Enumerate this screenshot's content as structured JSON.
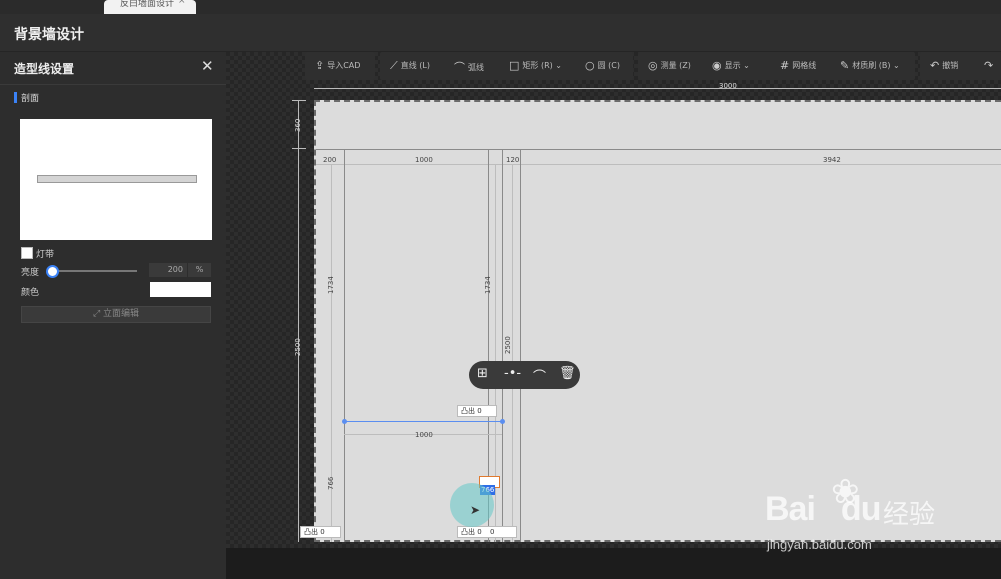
{
  "browser": {
    "tab_title": "反白墙面设计"
  },
  "app": {
    "title": "背景墙设计"
  },
  "panel": {
    "title": "造型线设置",
    "section": "剖面",
    "light_strip_label": "灯带",
    "brightness_label": "亮度",
    "brightness_value": "200",
    "brightness_unit": "%",
    "color_label": "颜色",
    "elevation_button": "立面编辑"
  },
  "toolbar": {
    "import_cad": "导入CAD",
    "line": "直线 (L)",
    "arc": "弧线",
    "rect": "矩形 (R)",
    "circle": "圆 (C)",
    "measure": "测量 (Z)",
    "display": "显示",
    "grid": "网格线",
    "brush": "材质刷 (B)",
    "undo": "撤销"
  },
  "dims": {
    "top_total": "3000",
    "left_top": "360",
    "left_total": "2500",
    "seg_200": "200",
    "seg_1000": "1000",
    "seg_120": "120",
    "seg_3942": "3942",
    "v_1734_a": "1734",
    "v_1734_b": "1734",
    "v_2500": "2500",
    "mid_1000": "1000",
    "v_766": "766"
  },
  "tags": {
    "protrude_label": "凸出",
    "protrude_value": "0",
    "active_value": "766"
  },
  "watermark": {
    "logo_a": "Bai",
    "logo_b": "du",
    "cn": "经验",
    "url": "jingyan.baidu.com"
  }
}
